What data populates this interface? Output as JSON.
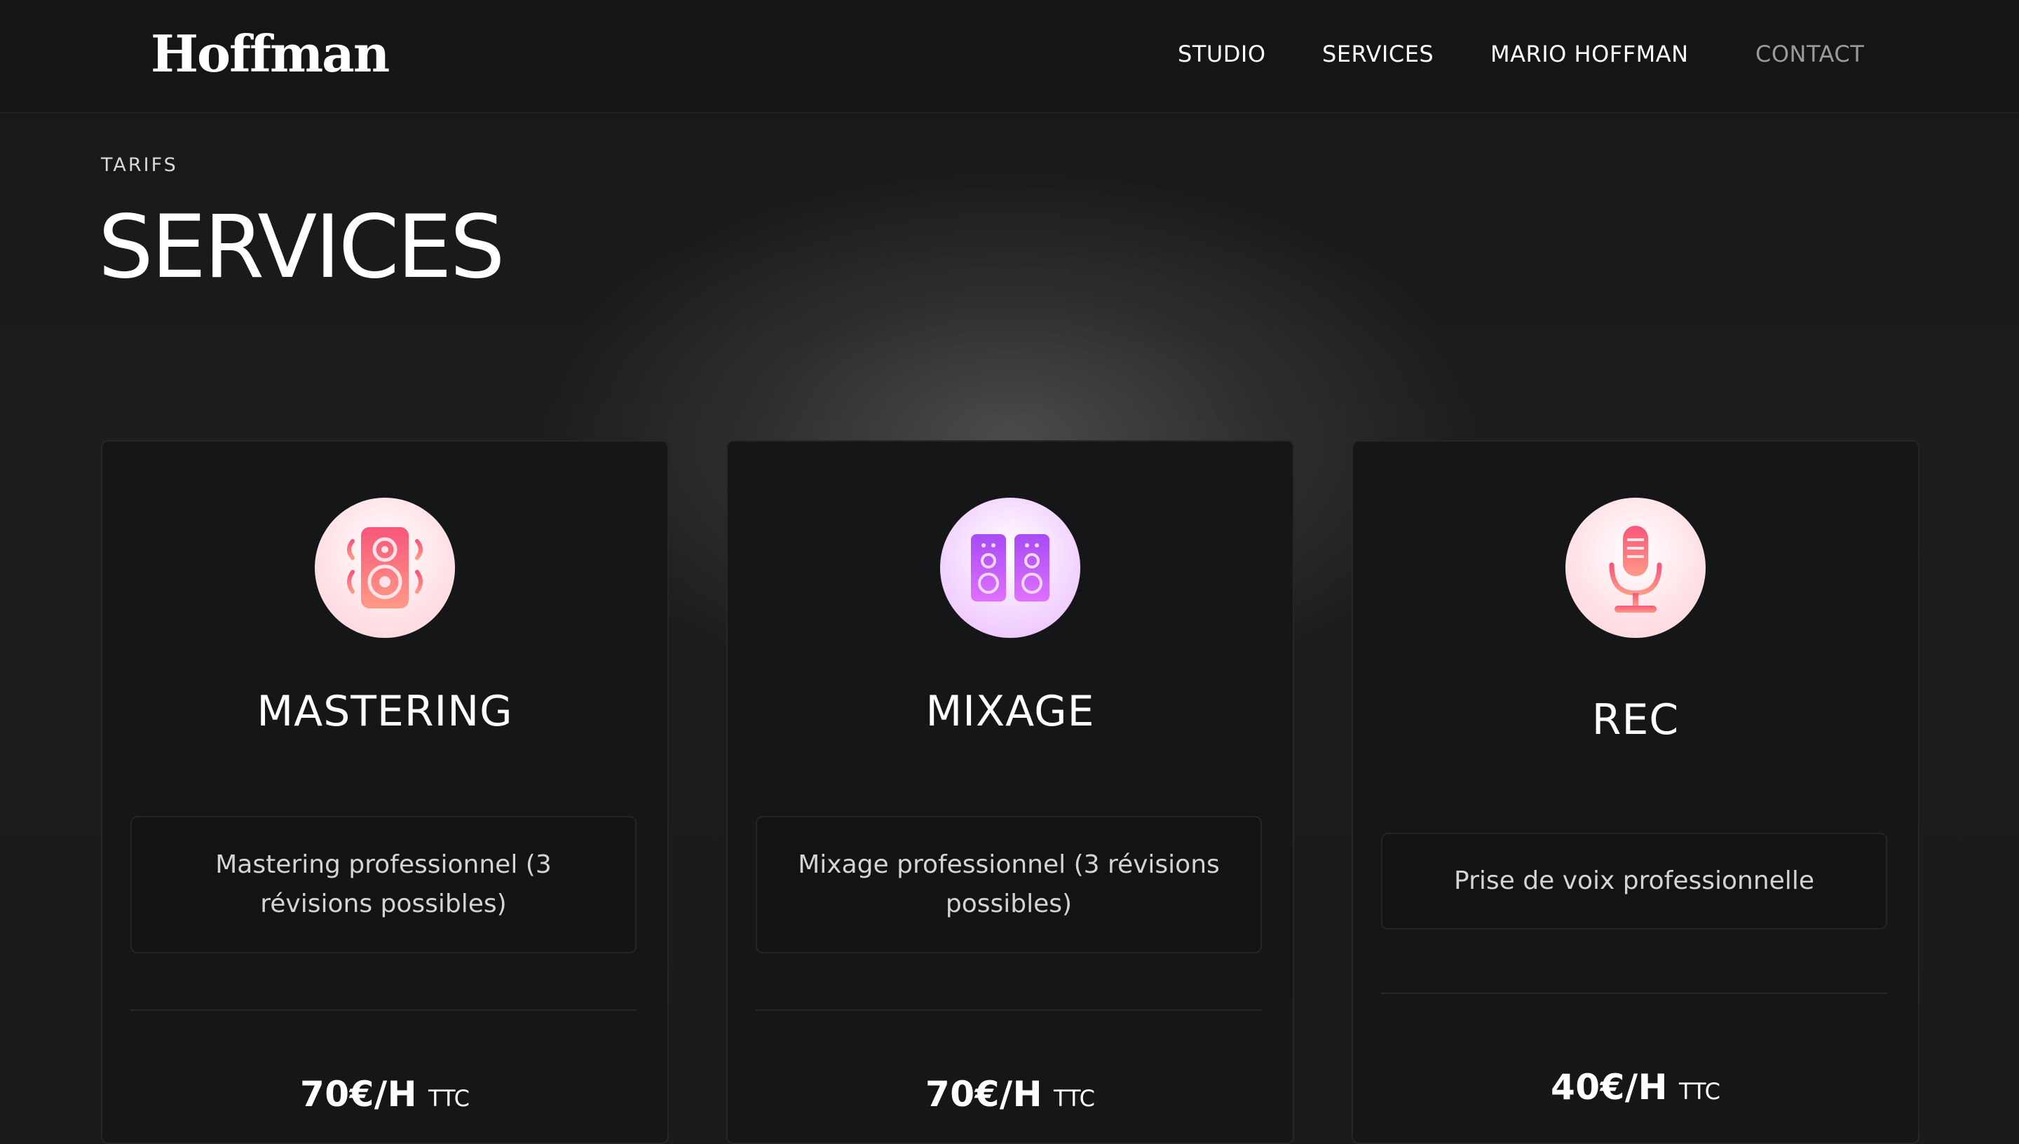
{
  "header": {
    "logo": "Hoffman",
    "nav": [
      {
        "label": "STUDIO"
      },
      {
        "label": "SERVICES"
      },
      {
        "label": "MARIO HOFFMAN"
      },
      {
        "label": "CONTACT"
      }
    ]
  },
  "section": {
    "eyebrow": "TARIFS",
    "title": "SERVICES"
  },
  "cards": [
    {
      "icon": "speaker-icon",
      "title": "MASTERING",
      "description": "Mastering professionnel (3 révisions possibles)",
      "price": "70€/H",
      "tax": "TTC"
    },
    {
      "icon": "twin-speakers-icon",
      "title": "MIXAGE",
      "description": "Mixage professionnel (3 révisions possibles)",
      "price": "70€/H",
      "tax": "TTC"
    },
    {
      "icon": "microphone-icon",
      "title": "REC",
      "description": "Prise de voix professionnelle",
      "price": "40€/H",
      "tax": "TTC"
    }
  ],
  "colors": {
    "background": "#1b1b1c",
    "card": "#141618",
    "accent_pink": "#f7567a",
    "accent_purple": "#b455f5",
    "nav_muted": "#9a9a9c"
  }
}
